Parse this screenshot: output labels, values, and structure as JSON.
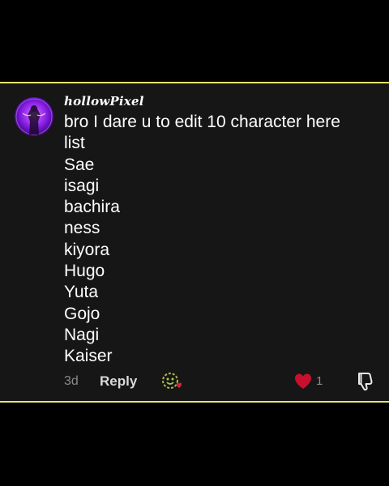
{
  "comment": {
    "username": "hollowPixel",
    "lines": [
      "bro I dare u to edit 10 character here",
      "list",
      "Sae",
      "isagi",
      "bachira",
      "ness",
      "kiyora",
      "Hugo",
      "Yuta",
      "Gojo",
      "Nagi",
      "Kaiser"
    ],
    "timestamp": "3d",
    "reply_label": "Reply",
    "like_count": "1",
    "liked": true
  },
  "colors": {
    "card_background": "#161616",
    "card_border": "#e6e36a",
    "like_heart": "#c8102e",
    "muted_text": "#8a8a8a"
  },
  "icons": {
    "avatar": "avatar-image",
    "emoji": "emoji-reaction-icon",
    "like": "heart-icon",
    "dislike": "thumbs-down-icon"
  }
}
